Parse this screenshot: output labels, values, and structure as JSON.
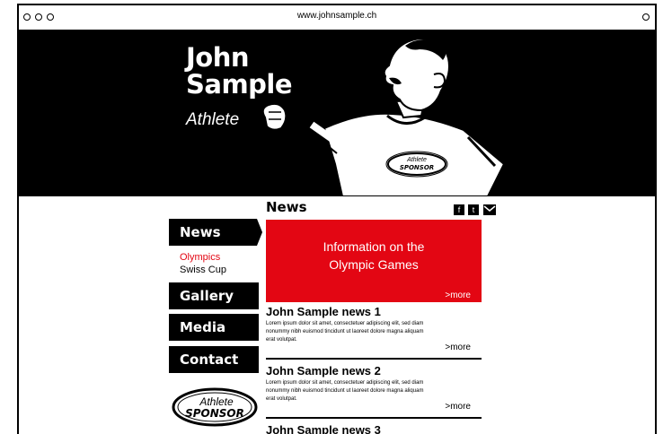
{
  "browser": {
    "url": "www.johnsample.ch"
  },
  "hero": {
    "name_line1": "John",
    "name_line2": "Sample",
    "subtitle": "Athlete",
    "shirt_logo_line1": "Athlete",
    "shirt_logo_line2": "SPONSOR"
  },
  "nav": {
    "news": "News",
    "sub_items": [
      "Olympics",
      "Swiss Cup"
    ],
    "gallery": "Gallery",
    "media": "Media",
    "contact": "Contact"
  },
  "sponsor": {
    "line1": "Athlete",
    "line2": "SPONSOR"
  },
  "news": {
    "heading": "News",
    "social": [
      "f",
      "t"
    ],
    "banner": {
      "line1": "Information on the",
      "line2": "Olympic Games",
      "more": ">more"
    },
    "items": [
      {
        "title": "John Sample news 1",
        "body": "Lorem ipsum dolor sit amet, consectetuer adipiscing elit, sed diam nonummy nibh euismod tincidunt ut laoreet dolore magna aliquam erat volutpat.",
        "more": ">more"
      },
      {
        "title": "John Sample news 2",
        "body": "Lorem ipsum dolor sit amet, consectetuer adipiscing elit, sed diam nonummy nibh euismod tincidunt ut laoreet dolore magna aliquam erat volutpat.",
        "more": ">more"
      },
      {
        "title": "John Sample news 3"
      }
    ]
  },
  "colors": {
    "accent": "#e30613",
    "primary": "#000000"
  }
}
